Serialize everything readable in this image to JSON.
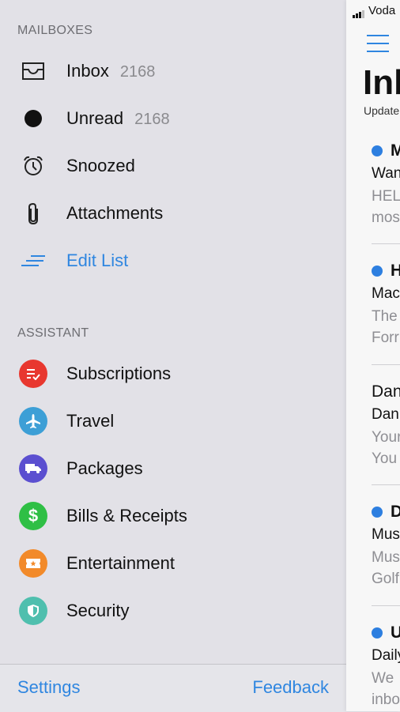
{
  "sidebar": {
    "mailboxes_header": "MAILBOXES",
    "mailboxes": [
      {
        "label": "Inbox",
        "count": "2168",
        "icon": "inbox-icon"
      },
      {
        "label": "Unread",
        "count": "2168",
        "icon": "unread-dot-icon"
      },
      {
        "label": "Snoozed",
        "count": "",
        "icon": "alarm-clock-icon"
      },
      {
        "label": "Attachments",
        "count": "",
        "icon": "paperclip-icon"
      }
    ],
    "edit_list_label": "Edit List",
    "assistant_header": "ASSISTANT",
    "assistant": [
      {
        "label": "Subscriptions",
        "icon": "list-check-icon",
        "color": "#e8372f"
      },
      {
        "label": "Travel",
        "icon": "airplane-icon",
        "color": "#3d9fd6"
      },
      {
        "label": "Packages",
        "icon": "truck-icon",
        "color": "#5b4fd0"
      },
      {
        "label": "Bills & Receipts",
        "icon": "dollar-icon",
        "color": "#2fbf45"
      },
      {
        "label": "Entertainment",
        "icon": "ticket-icon",
        "color": "#f28a2a"
      },
      {
        "label": "Security",
        "icon": "shield-icon",
        "color": "#4fbfae"
      }
    ],
    "footer": {
      "settings_label": "Settings",
      "feedback_label": "Feedback"
    }
  },
  "main": {
    "carrier": "Voda",
    "title": "Inb",
    "updated_text": "Update",
    "messages": [
      {
        "sender": "M",
        "subject": "Wan",
        "preview1": "HEL",
        "preview2": "mos",
        "unread": true
      },
      {
        "sender": "H",
        "subject": "Mac",
        "preview1": "The",
        "preview2": "Forr",
        "unread": true
      },
      {
        "sender": "Dan",
        "subject": "Dan",
        "preview1": "Your",
        "preview2": "You",
        "unread": false
      },
      {
        "sender": "D",
        "subject": "Mus",
        "preview1": "Mus",
        "preview2": "Golf",
        "unread": true
      },
      {
        "sender": "U",
        "subject": "Daily",
        "preview1": "We",
        "preview2": "inbo",
        "unread": true
      }
    ]
  },
  "colors": {
    "accent": "#2f86e0",
    "unread_dot": "#2d7fe0"
  }
}
